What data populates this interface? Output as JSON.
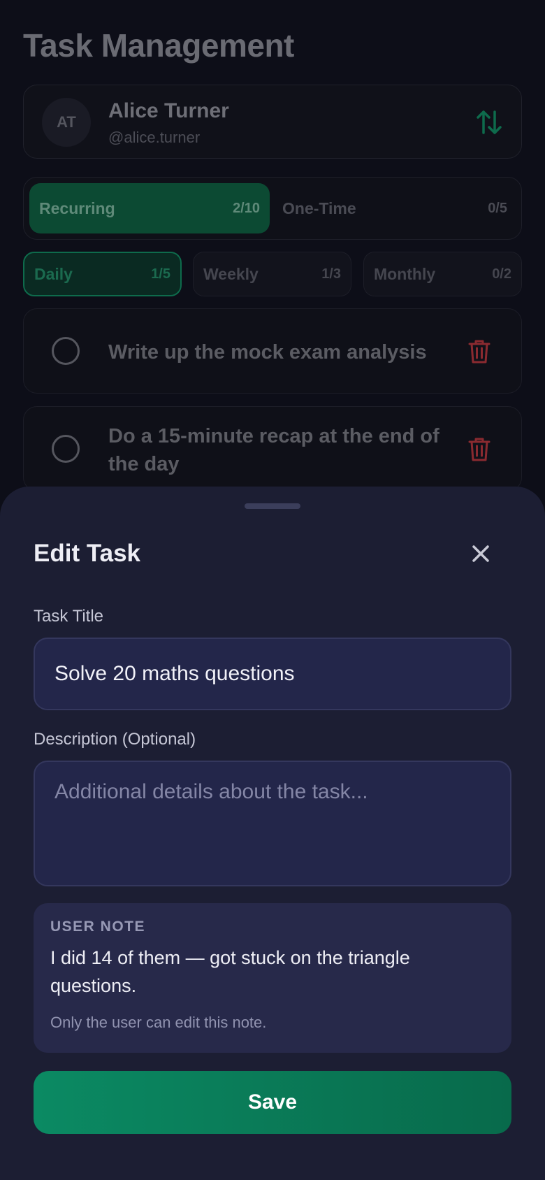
{
  "app": {
    "title": "Task Management"
  },
  "user": {
    "initials": "AT",
    "name": "Alice Turner",
    "handle": "@alice.turner"
  },
  "type_tabs": [
    {
      "label": "Recurring",
      "count": "2/10",
      "active": true
    },
    {
      "label": "One-Time",
      "count": "0/5",
      "active": false
    }
  ],
  "period_tabs": [
    {
      "label": "Daily",
      "count": "1/5",
      "active": true
    },
    {
      "label": "Weekly",
      "count": "1/3",
      "active": false
    },
    {
      "label": "Monthly",
      "count": "0/2",
      "active": false
    }
  ],
  "tasks": [
    {
      "title": "Write up the mock exam analysis",
      "done": false
    },
    {
      "title": "Do a 15-minute recap at the end of the day",
      "done": false
    }
  ],
  "edit_sheet": {
    "title": "Edit Task",
    "title_label": "Task Title",
    "title_value": "Solve 20 maths questions",
    "description_label": "Description (Optional)",
    "description_placeholder": "Additional details about the task...",
    "note_label": "USER NOTE",
    "note_text": "I did 14 of them — got stuck on the triangle questions.",
    "note_hint": "Only the user can edit this note.",
    "save_label": "Save"
  },
  "colors": {
    "accent": "#0b8a63",
    "danger": "#c0343a",
    "sheet_bg": "#1c1e33"
  },
  "icons": {
    "sort": "sort-arrows-icon",
    "delete": "trash-icon",
    "close": "close-icon"
  }
}
